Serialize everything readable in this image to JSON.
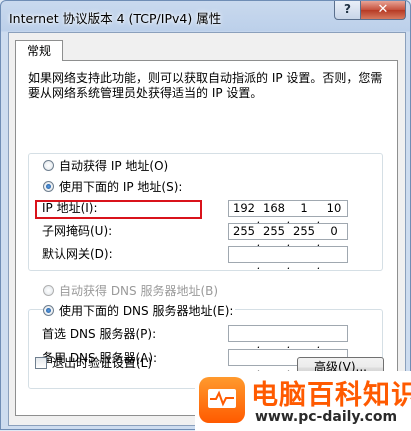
{
  "window": {
    "title": "Internet 协议版本 4 (TCP/IPv4) 属性",
    "help_label": "?",
    "close_label": "✕"
  },
  "tabs": [
    {
      "label": "常规",
      "active": true
    }
  ],
  "description": "如果网络支持此功能，则可以获取自动指派的 IP 设置。否则，您需要从网络系统管理员处获得适当的 IP 设置。",
  "ip_section": {
    "auto_label": "自动获得 IP 地址(O)",
    "manual_label": "使用下面的 IP 地址(S):",
    "selected": "manual",
    "fields": [
      {
        "label": "IP 地址(I):",
        "octets": [
          "192",
          "168",
          "1",
          "10"
        ]
      },
      {
        "label": "子网掩码(U):",
        "octets": [
          "255",
          "255",
          "255",
          "0"
        ]
      },
      {
        "label": "默认网关(D):",
        "octets": [
          "",
          "",
          "",
          ""
        ]
      }
    ]
  },
  "dns_section": {
    "auto_label": "自动获得 DNS 服务器地址(B)",
    "manual_label": "使用下面的 DNS 服务器地址(E):",
    "selected": "manual",
    "fields": [
      {
        "label": "首选 DNS 服务器(P):",
        "octets": [
          "",
          "",
          "",
          ""
        ]
      },
      {
        "label": "备用 DNS 服务器(A):",
        "octets": [
          "",
          "",
          "",
          ""
        ]
      }
    ]
  },
  "validate_on_exit": {
    "label": "退出时验证设置(L)",
    "checked": false
  },
  "advanced_button": "高级(V)...",
  "watermark": {
    "title": "电脑百科知识",
    "url": "www.pc-daily.com"
  },
  "colors": {
    "highlight": "#d9131b",
    "watermark_orange": "#ff5a00"
  }
}
